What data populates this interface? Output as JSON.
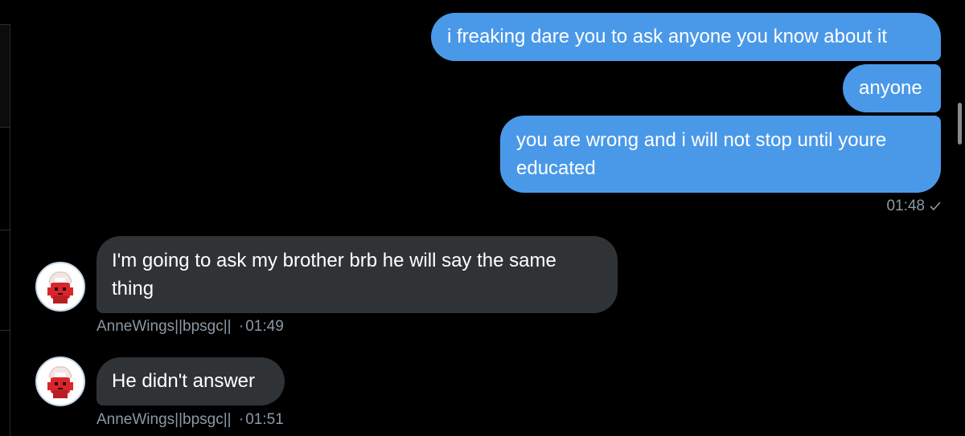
{
  "messages": [
    {
      "id": "b1",
      "direction": "outgoing",
      "text": "i freaking dare you to ask anyone you know about it"
    },
    {
      "id": "b2",
      "direction": "outgoing",
      "text": "anyone"
    },
    {
      "id": "b3",
      "direction": "outgoing",
      "text": "you are wrong and i will not stop until youre educated"
    },
    {
      "id": "b4",
      "direction": "incoming",
      "text": "I'm going to ask my brother brb he will say the same thing"
    },
    {
      "id": "b5",
      "direction": "incoming",
      "text": "He didn't answer"
    }
  ],
  "outgoing_meta": {
    "time": "01:48",
    "status_icon": "read-check-icon"
  },
  "incoming_meta": [
    {
      "sender": "AnneWings||bpsgc||",
      "separator": "·",
      "time": "01:49"
    },
    {
      "sender": "AnneWings||bpsgc||",
      "separator": "·",
      "time": "01:51"
    }
  ],
  "colors": {
    "background": "#000000",
    "outgoing_bubble": "#4a99e9",
    "incoming_bubble": "#2f3336",
    "meta_text": "#8b98a5"
  }
}
